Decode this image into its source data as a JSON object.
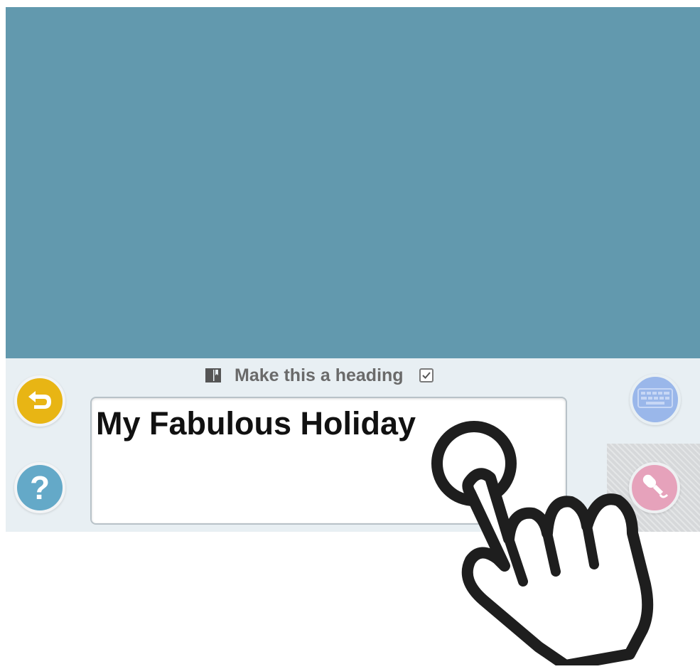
{
  "heading_toggle": {
    "label": "Make this a heading",
    "checked": true
  },
  "text_input": {
    "value": "My Fabulous Holiday"
  },
  "buttons": {
    "undo_icon": "undo-arrow-icon",
    "help_glyph": "?",
    "keyboard_icon": "keyboard-icon",
    "mic_icon": "microphone-icon"
  },
  "colors": {
    "canvas": "#6299ae",
    "toolbar": "#e8eff3",
    "undo": "#e8b514",
    "help": "#64a9c8",
    "keyboard": "#9ab7ea",
    "mic": "#e6a2bb"
  }
}
